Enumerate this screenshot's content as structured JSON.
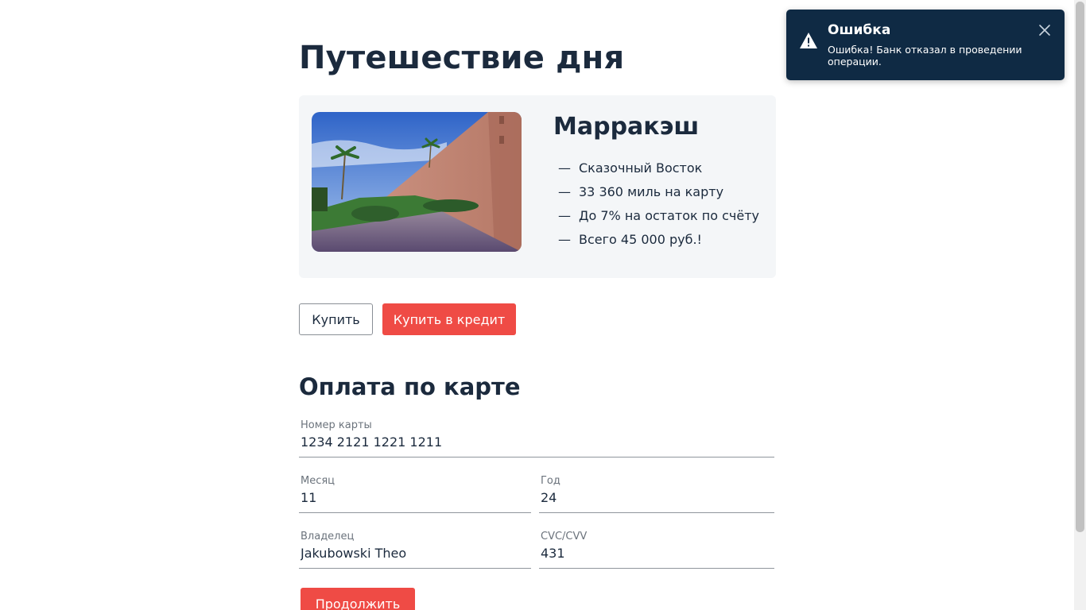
{
  "page": {
    "title": "Путешествие дня"
  },
  "offer": {
    "city": "Марракэш",
    "features": [
      "Сказочный Восток",
      "33 360 миль на карту",
      "До 7% на остаток по счёту",
      "Всего 45 000 руб.!"
    ],
    "dash": "—"
  },
  "actions": {
    "buy_label": "Купить",
    "credit_label": "Купить в кредит"
  },
  "payment": {
    "title": "Оплата по карте",
    "card_number": {
      "label": "Номер карты",
      "value": "1234 2121 1221 1211"
    },
    "month": {
      "label": "Месяц",
      "value": "11"
    },
    "year": {
      "label": "Год",
      "value": "24"
    },
    "owner": {
      "label": "Владелец",
      "value": "Jakubowski Theo"
    },
    "cvc": {
      "label": "CVC/CVV",
      "value": "431"
    },
    "continue_label": "Продолжить"
  },
  "notification": {
    "title": "Ошибка",
    "message": "Ошибка! Банк отказал в проведении операции.",
    "icon": "warning-icon",
    "close_icon": "close-icon"
  },
  "colors": {
    "accent": "#ef4b45",
    "text": "#1b2a3d",
    "toast_bg": "#0f2a44",
    "card_bg": "#f4f6f8"
  }
}
